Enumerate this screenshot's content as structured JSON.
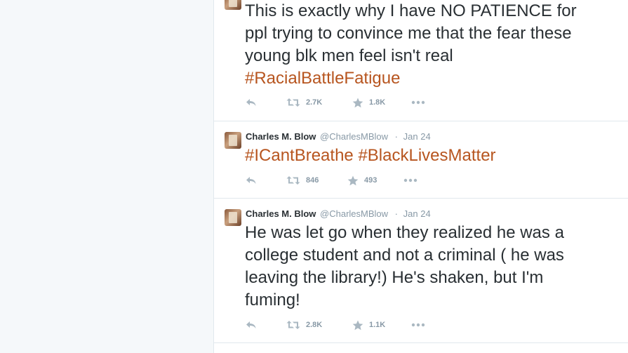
{
  "colors": {
    "hashtag": "#b7551f",
    "action_icon": "#aab8c2",
    "meta_text": "#8899a6"
  },
  "tweets": [
    {
      "lines": [
        "This is exactly why I have NO PATIENCE for",
        "ppl trying to convince me that the fear these",
        "young blk men feel isn't real"
      ],
      "hashtags": [
        "#RacialBattleFatigue"
      ],
      "retweets": "2.7K",
      "favorites": "1.8K",
      "icons": [
        "reply-icon",
        "retweet-icon",
        "favorite-icon",
        "more-icon"
      ]
    },
    {
      "name": "Charles M. Blow",
      "handle": "@CharlesMBlow",
      "separator": "·",
      "time": "Jan 24",
      "hashtags": [
        "#ICantBreathe",
        "#BlackLivesMatter"
      ],
      "retweets": "846",
      "favorites": "493",
      "icons": [
        "reply-icon",
        "retweet-icon",
        "favorite-icon",
        "more-icon"
      ]
    },
    {
      "name": "Charles M. Blow",
      "handle": "@CharlesMBlow",
      "separator": "·",
      "time": "Jan 24",
      "lines": [
        "He was let go when they realized he was a",
        "college student and not a criminal ( he was",
        "leaving the library!) He's shaken, but I'm",
        "fuming!"
      ],
      "retweets": "2.8K",
      "favorites": "1.1K",
      "icons": [
        "reply-icon",
        "retweet-icon",
        "favorite-icon",
        "more-icon"
      ]
    }
  ]
}
